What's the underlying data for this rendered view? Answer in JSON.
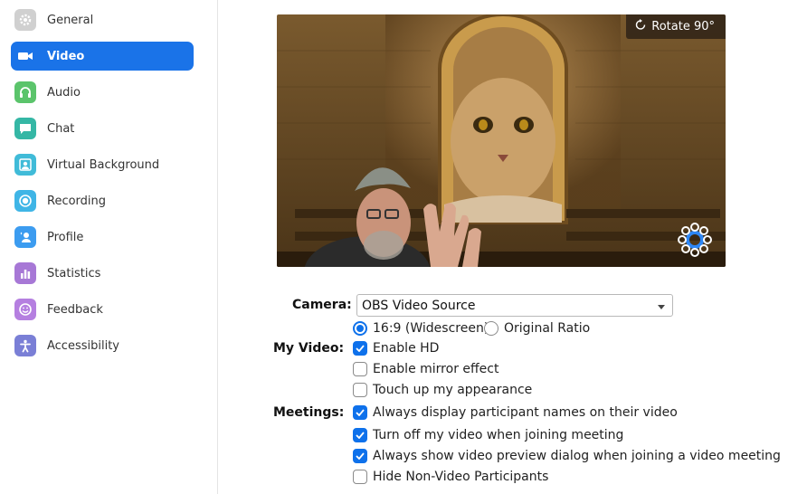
{
  "sidebar": {
    "items": [
      {
        "label": "General",
        "icon": "gear-icon",
        "color": "#c7c7c7"
      },
      {
        "label": "Video",
        "icon": "video-camera-icon",
        "color": "#1a73e8"
      },
      {
        "label": "Audio",
        "icon": "headphones-icon",
        "color": "#5bc46b"
      },
      {
        "label": "Chat",
        "icon": "chat-bubble-icon",
        "color": "#35b7a5"
      },
      {
        "label": "Virtual Background",
        "icon": "person-portrait-icon",
        "color": "#40bbd8"
      },
      {
        "label": "Recording",
        "icon": "record-icon",
        "color": "#3fb5e6"
      },
      {
        "label": "Profile",
        "icon": "profile-icon",
        "color": "#3c9cf0"
      },
      {
        "label": "Statistics",
        "icon": "bar-chart-icon",
        "color": "#a778d6"
      },
      {
        "label": "Feedback",
        "icon": "smiley-icon",
        "color": "#b57fe0"
      },
      {
        "label": "Accessibility",
        "icon": "accessibility-icon",
        "color": "#7a7fd6"
      }
    ],
    "active_index": 1
  },
  "preview": {
    "rotate_label": "Rotate 90°"
  },
  "camera": {
    "label": "Camera:",
    "selected": "OBS Video Source"
  },
  "my_video": {
    "label": "My Video:",
    "ratio_options": [
      {
        "label": "16:9 (Widescreen)",
        "selected": true
      },
      {
        "label": "Original Ratio",
        "selected": false
      }
    ],
    "checkboxes": [
      {
        "label": "Enable HD",
        "checked": true
      },
      {
        "label": "Enable mirror effect",
        "checked": false
      },
      {
        "label": "Touch up my appearance",
        "checked": false
      }
    ]
  },
  "meetings": {
    "label": "Meetings:",
    "checkboxes": [
      {
        "label": "Always display participant names on their video",
        "checked": true
      },
      {
        "label": "Turn off my video when joining meeting",
        "checked": true
      },
      {
        "label": "Always show video preview dialog when joining a video meeting",
        "checked": true
      },
      {
        "label": "Hide Non-Video Participants",
        "checked": false
      }
    ]
  }
}
